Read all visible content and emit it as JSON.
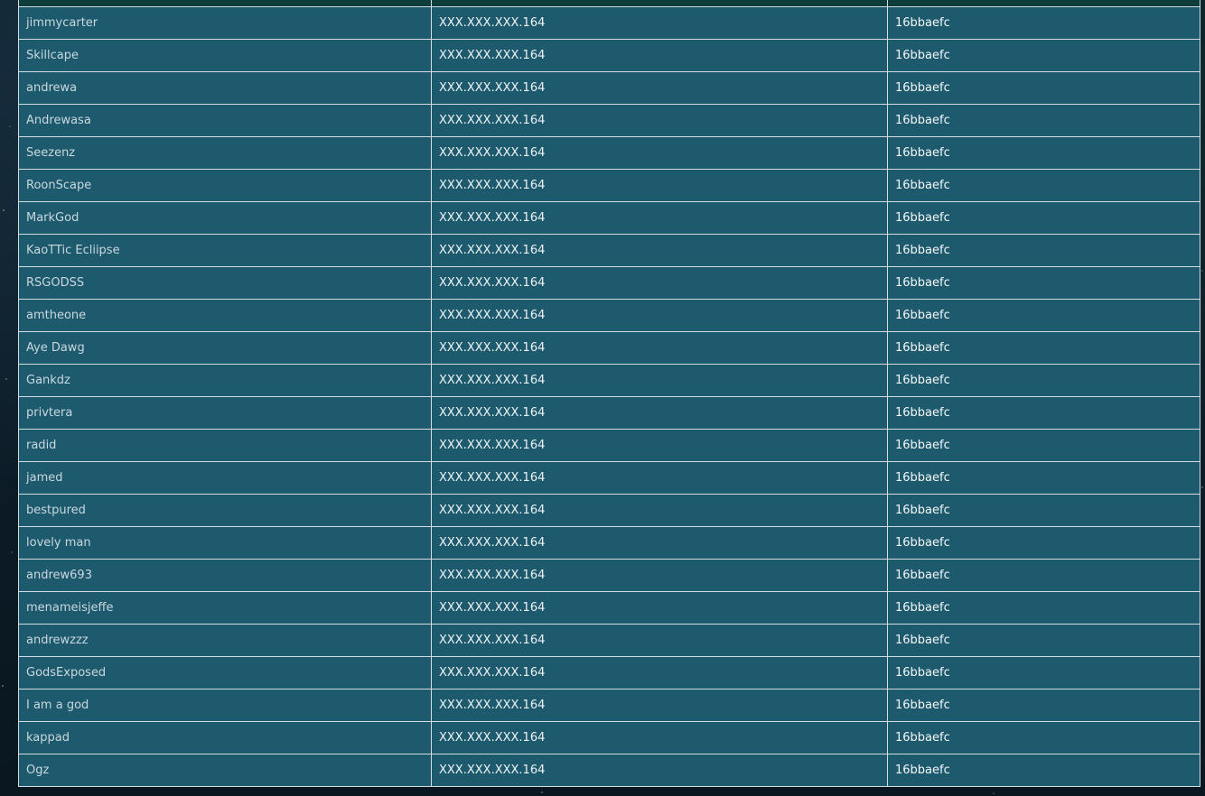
{
  "colors": {
    "row_background": "#1e5a6e",
    "border": "#d5dde2",
    "page_background": "#0a1a24",
    "header_strip": "#0f3d3b"
  },
  "rows": [
    {
      "name": "jimmycarter",
      "ip": "XXX.XXX.XXX.164",
      "hash": "16bbaefc"
    },
    {
      "name": "Skillcape",
      "ip": "XXX.XXX.XXX.164",
      "hash": "16bbaefc"
    },
    {
      "name": "andrewa",
      "ip": "XXX.XXX.XXX.164",
      "hash": "16bbaefc"
    },
    {
      "name": "Andrewasa",
      "ip": "XXX.XXX.XXX.164",
      "hash": "16bbaefc"
    },
    {
      "name": "Seezenz",
      "ip": "XXX.XXX.XXX.164",
      "hash": "16bbaefc"
    },
    {
      "name": "RoonScape",
      "ip": "XXX.XXX.XXX.164",
      "hash": "16bbaefc"
    },
    {
      "name": "MarkGod",
      "ip": "XXX.XXX.XXX.164",
      "hash": "16bbaefc"
    },
    {
      "name": "KaoTTic Ecliipse",
      "ip": "XXX.XXX.XXX.164",
      "hash": "16bbaefc"
    },
    {
      "name": "RSGODSS",
      "ip": "XXX.XXX.XXX.164",
      "hash": "16bbaefc"
    },
    {
      "name": "amtheone",
      "ip": "XXX.XXX.XXX.164",
      "hash": "16bbaefc"
    },
    {
      "name": "Aye Dawg",
      "ip": "XXX.XXX.XXX.164",
      "hash": "16bbaefc"
    },
    {
      "name": "Gankdz",
      "ip": "XXX.XXX.XXX.164",
      "hash": "16bbaefc"
    },
    {
      "name": "privtera",
      "ip": "XXX.XXX.XXX.164",
      "hash": "16bbaefc"
    },
    {
      "name": "radid",
      "ip": "XXX.XXX.XXX.164",
      "hash": "16bbaefc"
    },
    {
      "name": "jamed",
      "ip": "XXX.XXX.XXX.164",
      "hash": "16bbaefc"
    },
    {
      "name": "bestpured",
      "ip": "XXX.XXX.XXX.164",
      "hash": "16bbaefc"
    },
    {
      "name": "lovely man",
      "ip": "XXX.XXX.XXX.164",
      "hash": "16bbaefc"
    },
    {
      "name": "andrew693",
      "ip": "XXX.XXX.XXX.164",
      "hash": "16bbaefc"
    },
    {
      "name": "menameisjeffe",
      "ip": "XXX.XXX.XXX.164",
      "hash": "16bbaefc"
    },
    {
      "name": "andrewzzz",
      "ip": "XXX.XXX.XXX.164",
      "hash": "16bbaefc"
    },
    {
      "name": "GodsExposed",
      "ip": "XXX.XXX.XXX.164",
      "hash": "16bbaefc"
    },
    {
      "name": "I am a god",
      "ip": "XXX.XXX.XXX.164",
      "hash": "16bbaefc"
    },
    {
      "name": "kappad",
      "ip": "XXX.XXX.XXX.164",
      "hash": "16bbaefc"
    },
    {
      "name": "Ogz",
      "ip": "XXX.XXX.XXX.164",
      "hash": "16bbaefc"
    }
  ]
}
